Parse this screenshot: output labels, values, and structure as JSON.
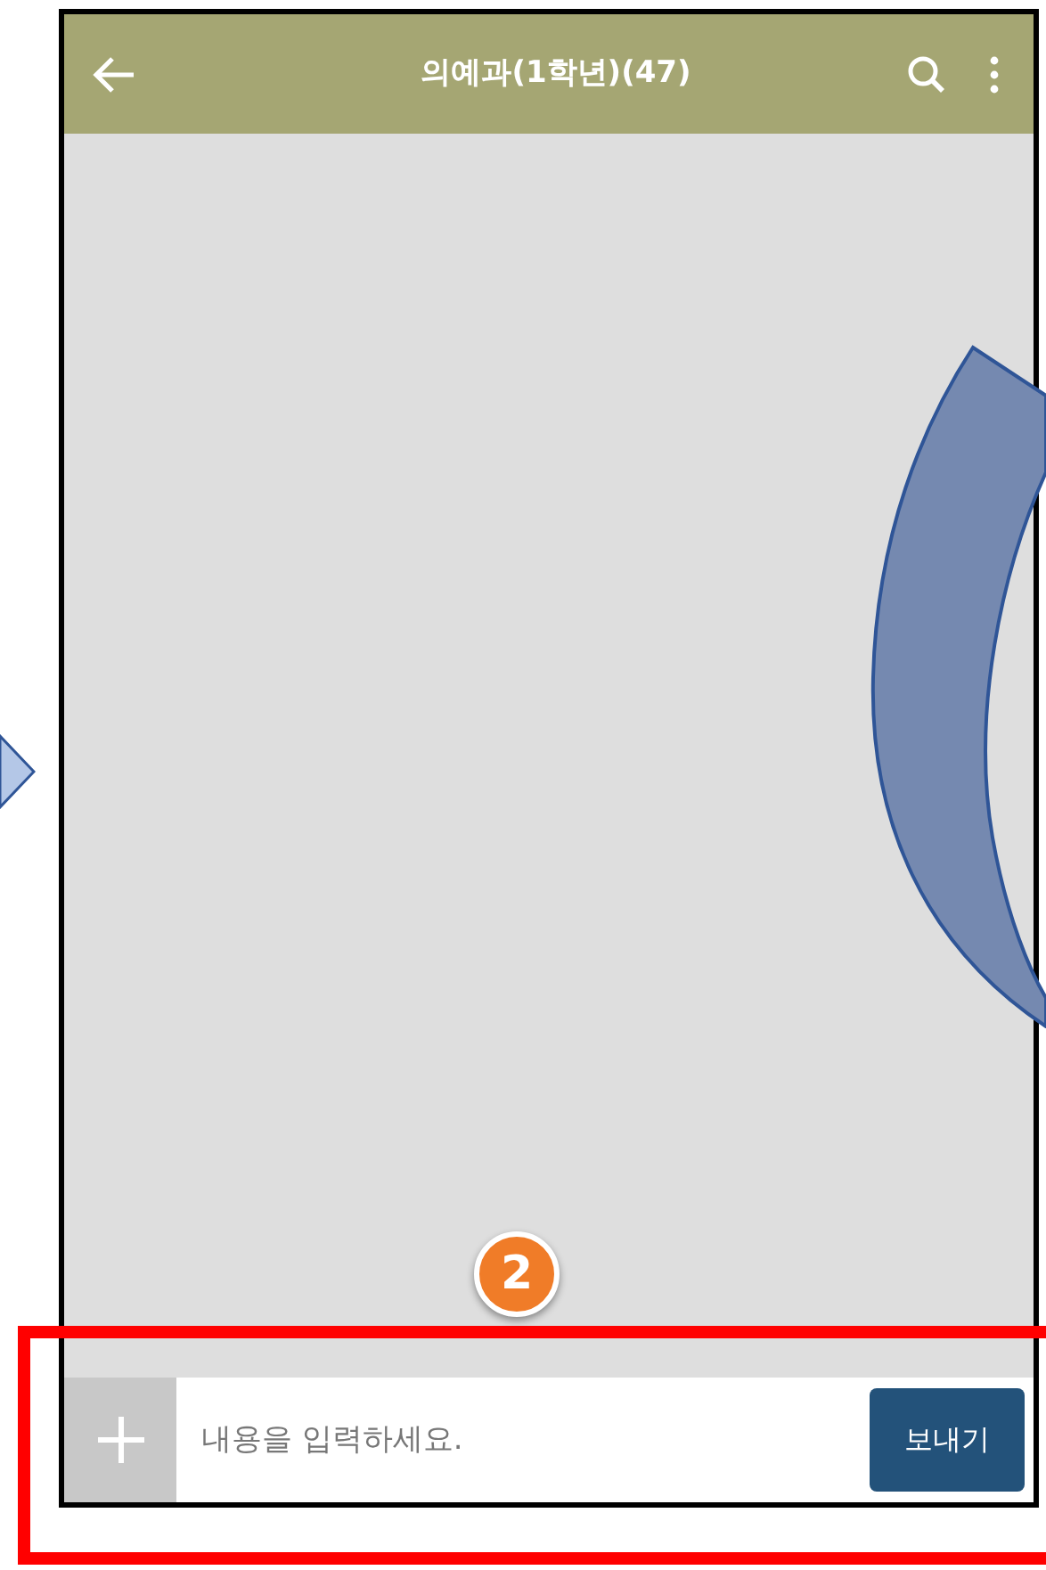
{
  "header": {
    "title": "의예과(1학년)(47)"
  },
  "composer": {
    "placeholder": "내용을 입력하세요.",
    "send_label": "보내기"
  },
  "annotation": {
    "label": "2"
  }
}
